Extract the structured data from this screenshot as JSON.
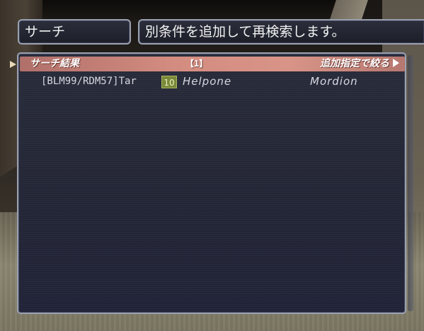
{
  "search_window": {
    "title": "サーチ",
    "hint": "別条件を追加して再検索します。"
  },
  "results": {
    "header_title": "サーチ結果",
    "count": "【1】",
    "filter_label": "追加指定で絞る",
    "rows": [
      {
        "comment": "[BLM99/RDM57]Tar",
        "level": "10",
        "name": "Helpone",
        "area": "Mordion"
      }
    ]
  },
  "icons": {
    "filter": "triangle-right-icon",
    "cursor": "cursor-pointer-icon"
  },
  "colors": {
    "header_bar": "#d38c80",
    "window_bg": "#252838",
    "level_badge": "#7a8a3a"
  }
}
